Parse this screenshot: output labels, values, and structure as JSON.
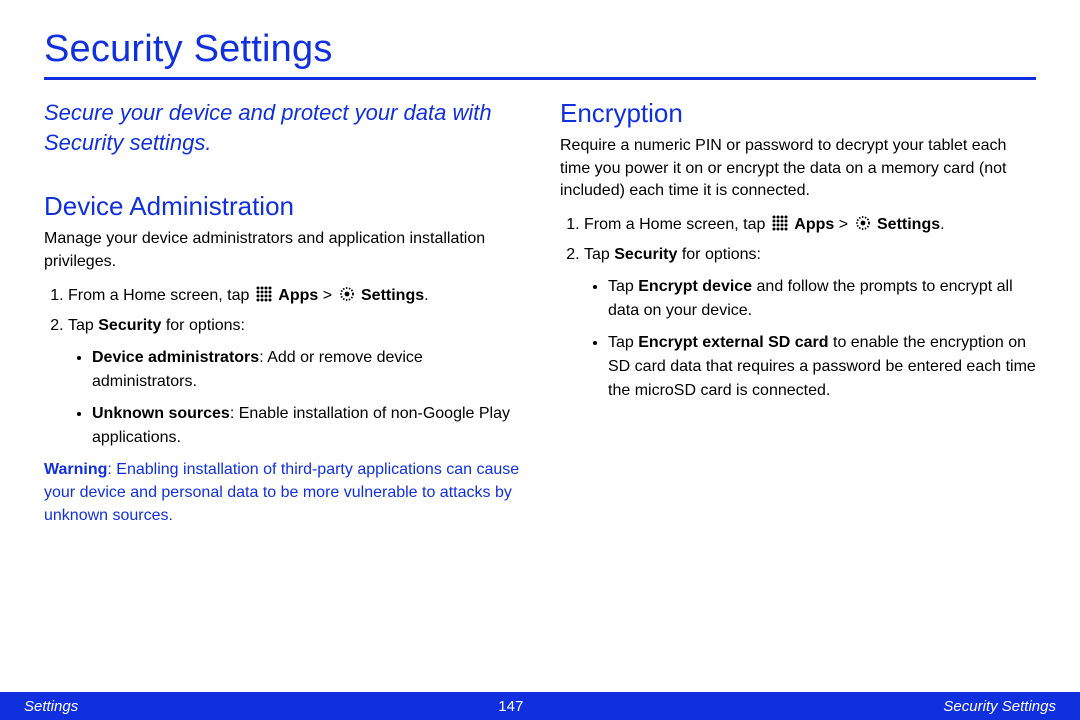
{
  "title": "Security Settings",
  "lede": "Secure your device and protect your data with Security settings.",
  "left": {
    "heading": "Device Administration",
    "intro": "Manage your device administrators and application installation privileges.",
    "step1a": "From a Home screen, tap ",
    "step1b": "Apps",
    "step1c": " > ",
    "step1d": "Settings",
    "step1e": ".",
    "step2a": "Tap ",
    "step2b": "Security",
    "step2c": " for options:",
    "bullet1a": "Device administrators",
    "bullet1b": ": Add or remove device administrators.",
    "bullet2a": "Unknown sources",
    "bullet2b": ": Enable installation of non-Google Play applications.",
    "warnLabel": "Warning",
    "warnText": ": Enabling installation of third-party applications can cause your device and personal data to be more vulnerable to attacks by unknown sources."
  },
  "right": {
    "heading": "Encryption",
    "intro": "Require a numeric PIN or password to decrypt your tablet each time you power it on or encrypt the data on a memory card (not included) each time it is connected.",
    "step1a": "From a Home screen, tap ",
    "step1b": "Apps",
    "step1c": " > ",
    "step1d": "Settings",
    "step1e": ".",
    "step2a": "Tap ",
    "step2b": "Security",
    "step2c": " for options:",
    "bullet1a": "Tap ",
    "bullet1b": "Encrypt device",
    "bullet1c": " and follow the prompts to encrypt all data on your device.",
    "bullet2a": "Tap ",
    "bullet2b": "Encrypt external SD card",
    "bullet2c": " to enable the encryption on SD card data that requires a password be entered each time the microSD card is connected."
  },
  "footer": {
    "left": "Settings",
    "page": "147",
    "right": "Security Settings"
  }
}
